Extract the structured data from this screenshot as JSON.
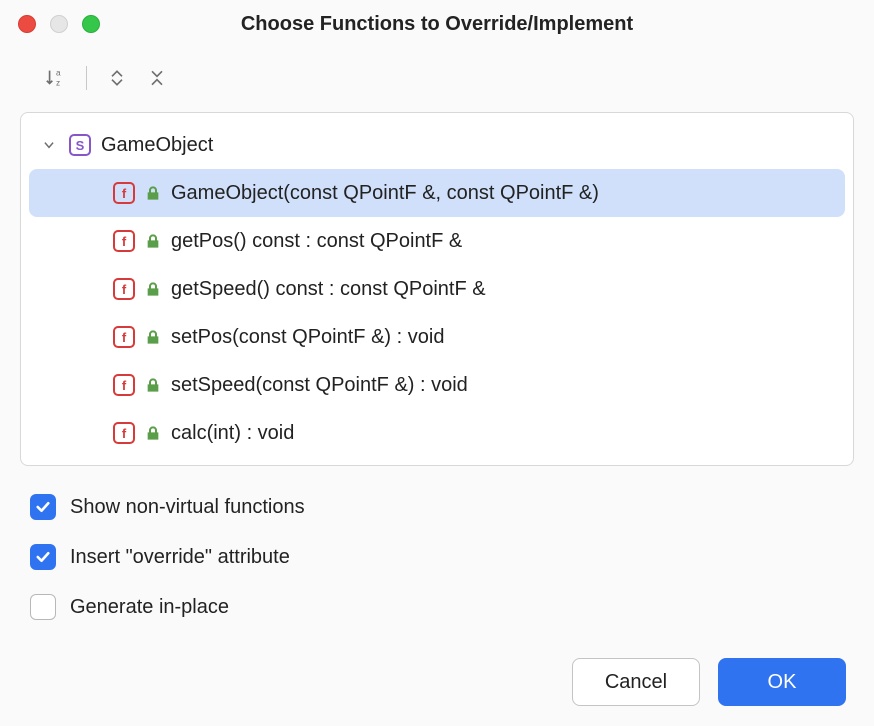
{
  "title": "Choose Functions to Override/Implement",
  "tree": {
    "class_name": "GameObject",
    "class_icon_letter": "S",
    "functions": [
      {
        "label": "GameObject(const QPointF &, const QPointF &)",
        "selected": true
      },
      {
        "label": "getPos() const : const QPointF &",
        "selected": false
      },
      {
        "label": "getSpeed() const : const QPointF &",
        "selected": false
      },
      {
        "label": "setPos(const QPointF &) : void",
        "selected": false
      },
      {
        "label": "setSpeed(const QPointF &) : void",
        "selected": false
      },
      {
        "label": "calc(int) : void",
        "selected": false
      }
    ]
  },
  "options": {
    "show_non_virtual": {
      "label": "Show non-virtual functions",
      "checked": true
    },
    "insert_override": {
      "label": "Insert \"override\" attribute",
      "checked": true
    },
    "generate_inplace": {
      "label": "Generate in-place",
      "checked": false
    }
  },
  "buttons": {
    "cancel": "Cancel",
    "ok": "OK"
  }
}
